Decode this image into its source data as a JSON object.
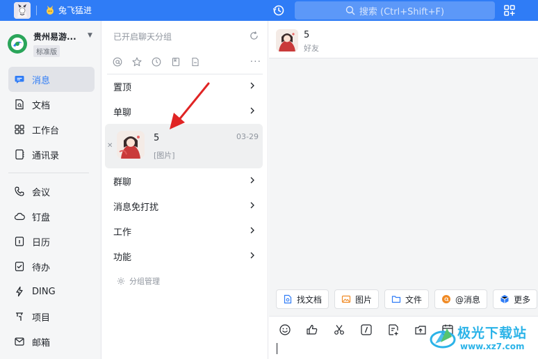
{
  "topbar": {
    "org_label": "兔飞猛进",
    "search_placeholder": "搜索 (Ctrl+Shift+F)",
    "accent_color": "#2f7cf6"
  },
  "org": {
    "name": "贵州易游...",
    "tag": "标准版"
  },
  "nav": {
    "primary": [
      {
        "label": "消息",
        "icon": "message-icon",
        "active": true
      },
      {
        "label": "文档",
        "icon": "document-icon"
      },
      {
        "label": "工作台",
        "icon": "apps-grid-icon"
      },
      {
        "label": "通讯录",
        "icon": "contacts-icon"
      }
    ],
    "secondary": [
      {
        "label": "会议",
        "icon": "phone-icon"
      },
      {
        "label": "钉盘",
        "icon": "cloud-icon"
      },
      {
        "label": "日历",
        "icon": "calendar-icon"
      },
      {
        "label": "待办",
        "icon": "checklist-icon"
      },
      {
        "label": "DING",
        "icon": "lightning-icon"
      },
      {
        "label": "项目",
        "icon": "project-icon"
      },
      {
        "label": "邮箱",
        "icon": "mail-icon"
      }
    ]
  },
  "middle": {
    "group_hint": "已开启聊天分组",
    "sections": {
      "pinned": "置顶",
      "single": "单聊",
      "group": "群聊",
      "muted": "消息免打扰",
      "work": "工作",
      "function": "功能"
    },
    "chat": {
      "name": "5",
      "time": "03-29",
      "preview": "[图片]"
    },
    "group_manage": "分组管理"
  },
  "chat": {
    "title": "5",
    "subtitle": "好友",
    "quick_actions": [
      "找文档",
      "图片",
      "文件",
      "@消息",
      "更多"
    ]
  },
  "watermark": {
    "line1": "极光下载站",
    "line2": "www.xz7.com"
  }
}
